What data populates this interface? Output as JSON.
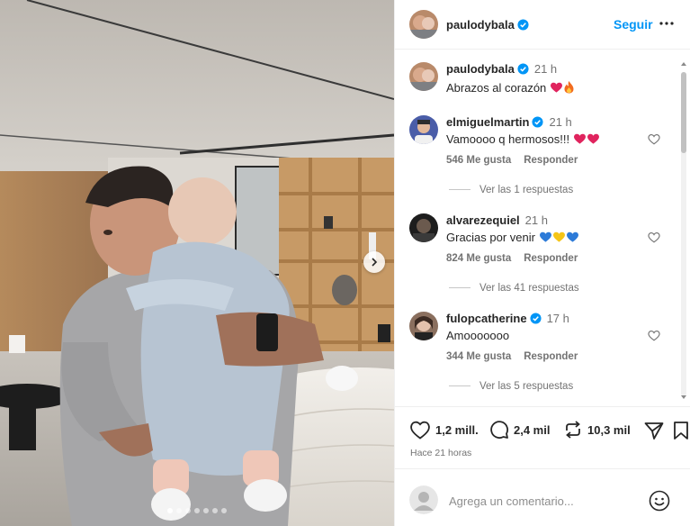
{
  "post": {
    "author": "paulodybala",
    "follow_label": "Seguir",
    "caption_time": "21 h",
    "caption_text": "Abrazos al corazón",
    "carousel_slides": 7,
    "carousel_active": 0
  },
  "comments": [
    {
      "username": "elmiguelmartin",
      "verified": true,
      "time": "21 h",
      "text": "Vamoooo q hermosos!!!",
      "likes": "546 Me gusta",
      "reply_label": "Responder",
      "replies": "Ver las 1 respuestas"
    },
    {
      "username": "alvarezequiel",
      "verified": false,
      "time": "21 h",
      "text": "Gracias por venir",
      "likes": "824 Me gusta",
      "reply_label": "Responder",
      "replies": "Ver las 41 respuestas"
    },
    {
      "username": "fulopcatherine",
      "verified": true,
      "time": "17 h",
      "text": "Amooooooo",
      "likes": "344 Me gusta",
      "reply_label": "Responder",
      "replies": "Ver las 5 respuestas"
    }
  ],
  "actions": {
    "likes": "1,2 mill.",
    "comments": "2,4 mil",
    "reposts": "10,3 mil",
    "posted_ago": "Hace 21 horas"
  },
  "add_comment": {
    "placeholder": "Agrega un comentario..."
  },
  "colors": {
    "accent": "#0095f6",
    "verified": "#0095f6",
    "heart_red": "#e0245e",
    "muted": "#737373"
  }
}
